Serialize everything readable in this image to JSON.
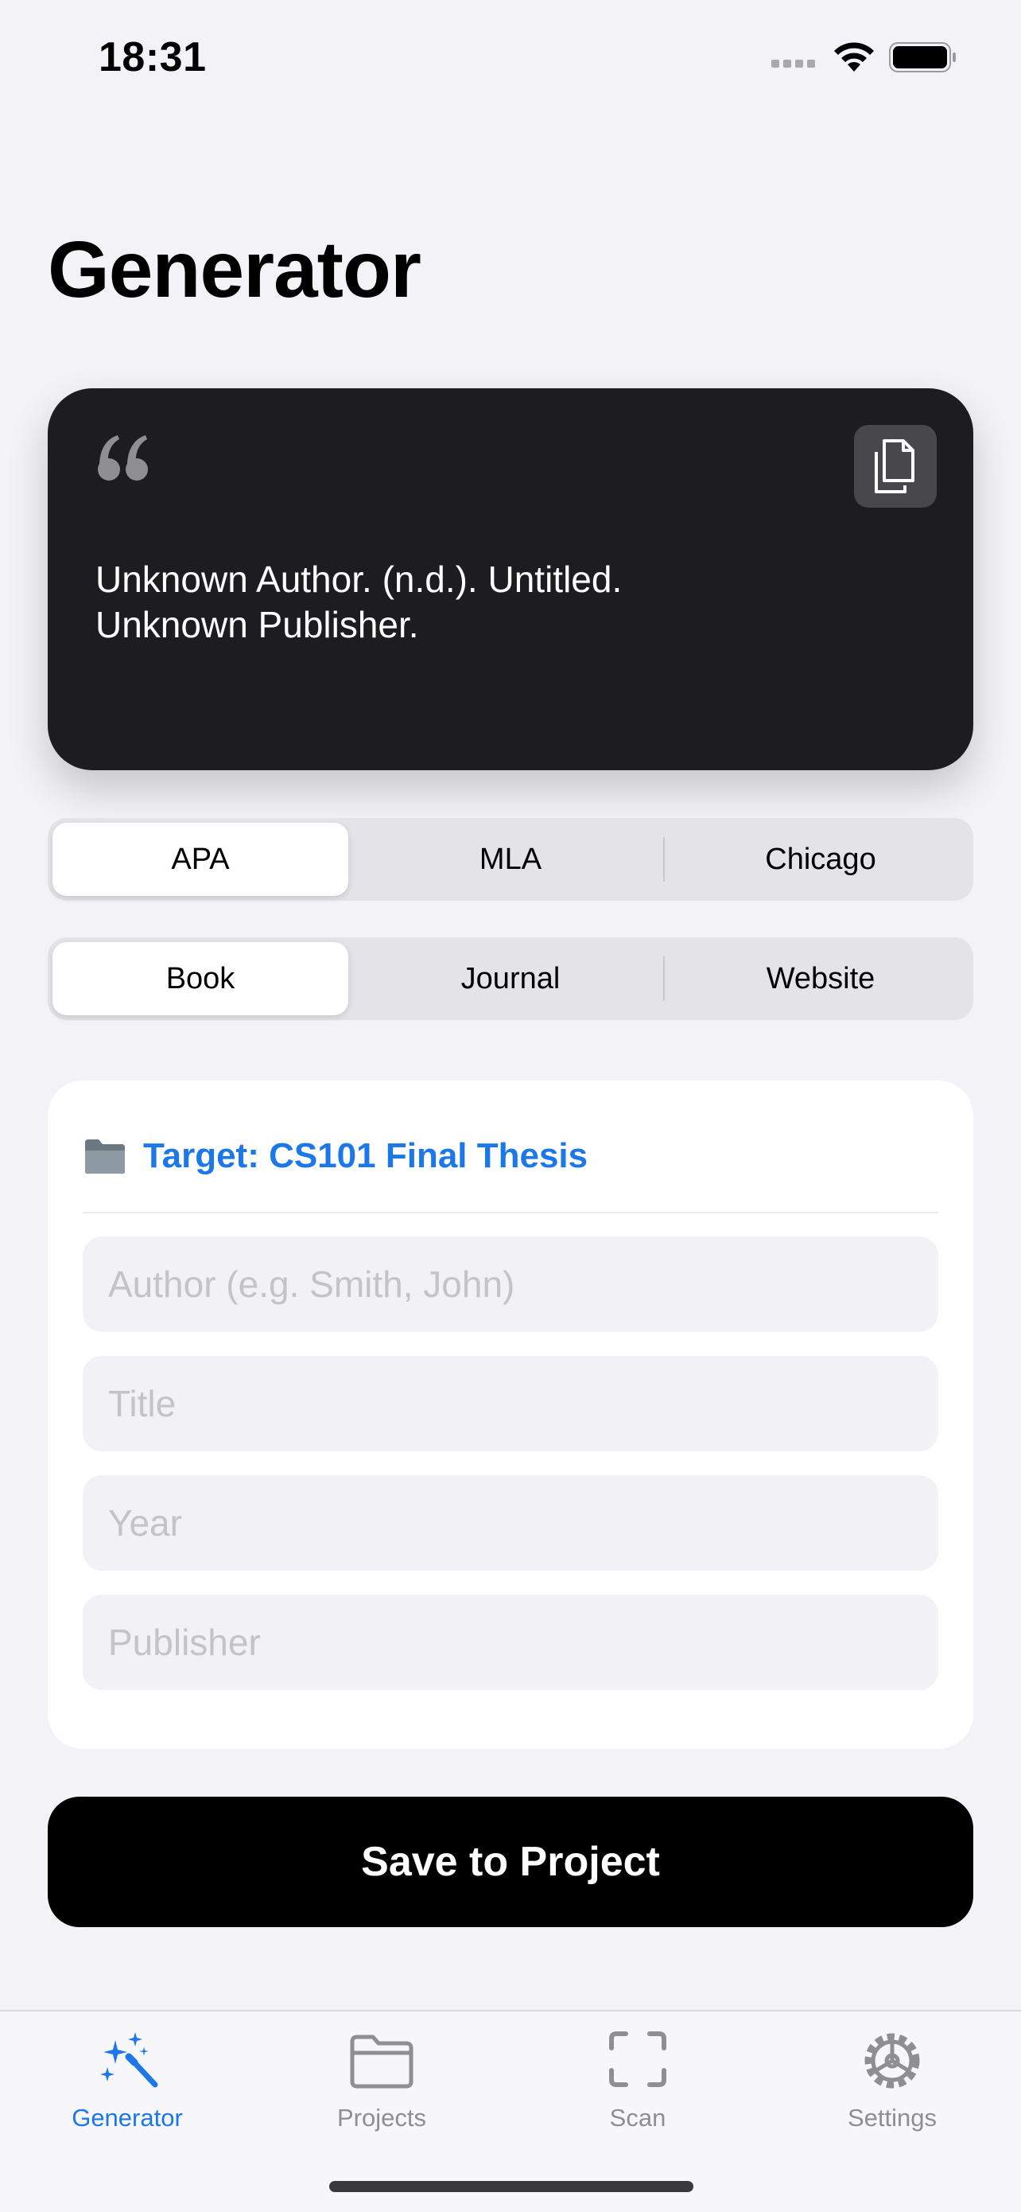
{
  "status_bar": {
    "time": "18:31"
  },
  "page": {
    "title": "Generator"
  },
  "citation": {
    "line1": "Unknown Author. (n.d.). Untitled.",
    "line2": "Unknown Publisher.",
    "quote_icon": "quote-open-icon",
    "copy_icon": "copy-icon"
  },
  "style_options": {
    "items": [
      "APA",
      "MLA",
      "Chicago"
    ],
    "selected": "APA"
  },
  "source_types": {
    "items": [
      "Book",
      "Journal",
      "Website"
    ],
    "selected": "Book"
  },
  "form": {
    "target_icon": "folder-icon",
    "target_label": "Target: CS101 Final Thesis",
    "fields": [
      {
        "placeholder": "Author (e.g. Smith, John)",
        "value": ""
      },
      {
        "placeholder": "Title",
        "value": ""
      },
      {
        "placeholder": "Year",
        "value": ""
      },
      {
        "placeholder": "Publisher",
        "value": ""
      }
    ]
  },
  "actions": {
    "save_label": "Save to Project"
  },
  "tab_bar": {
    "items": [
      {
        "label": "Generator",
        "icon": "magic-wand-icon",
        "active": true
      },
      {
        "label": "Projects",
        "icon": "folder-icon",
        "active": false
      },
      {
        "label": "Scan",
        "icon": "scan-icon",
        "active": false
      },
      {
        "label": "Settings",
        "icon": "gear-icon",
        "active": false
      }
    ]
  },
  "colors": {
    "accent": "#1c78e8",
    "card_dark": "#1c1c21",
    "background": "#f2f2f7"
  }
}
